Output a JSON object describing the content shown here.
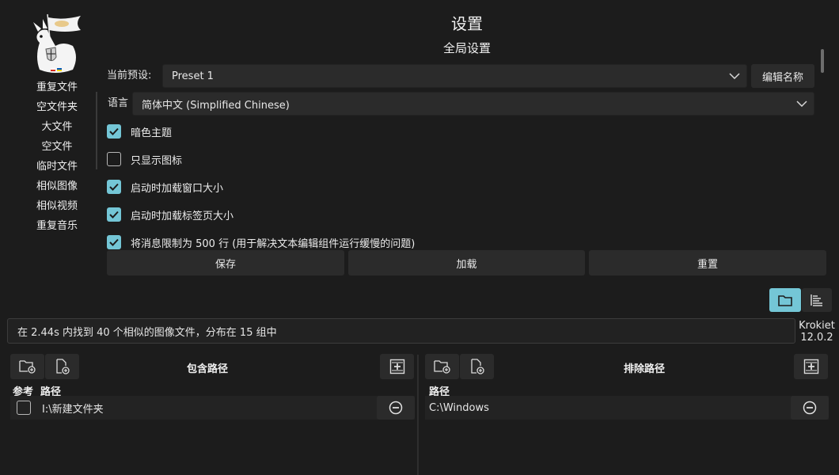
{
  "sidebar": {
    "items": [
      "重复文件",
      "空文件夹",
      "大文件",
      "空文件",
      "临时文件",
      "相似图像",
      "相似视频",
      "重复音乐"
    ]
  },
  "header": {
    "title": "设置",
    "section": "全局设置"
  },
  "preset": {
    "label": "当前预设:",
    "value": "Preset 1",
    "edit_label": "编辑名称"
  },
  "language": {
    "label": "语言",
    "value": "简体中文 (Simplified Chinese)"
  },
  "options": [
    {
      "label": "暗色主题",
      "checked": true
    },
    {
      "label": "只显示图标",
      "checked": false
    },
    {
      "label": "启动时加载窗口大小",
      "checked": true
    },
    {
      "label": "启动时加载标签页大小",
      "checked": true
    },
    {
      "label": "将消息限制为 500 行 (用于解决文本编辑组件运行缓慢的问题)",
      "checked": true
    }
  ],
  "actions": {
    "save": "保存",
    "load": "加载",
    "reset": "重置"
  },
  "status": {
    "message": "在 2.44s 内找到 40 个相似的图像文件，分布在 15 组中"
  },
  "app": {
    "name": "Krokiet",
    "version": "12.0.2"
  },
  "included": {
    "title": "包含路径",
    "col_ref": "参考",
    "col_path": "路径",
    "rows": [
      {
        "path": "I:\\新建文件夹",
        "reference": false
      }
    ]
  },
  "excluded": {
    "title": "排除路径",
    "col_path": "路径",
    "rows": [
      {
        "path": "C:\\Windows"
      }
    ]
  },
  "colors": {
    "accent": "#74c6d6",
    "background": "#1c1c1c",
    "control": "#2b2b2b"
  }
}
